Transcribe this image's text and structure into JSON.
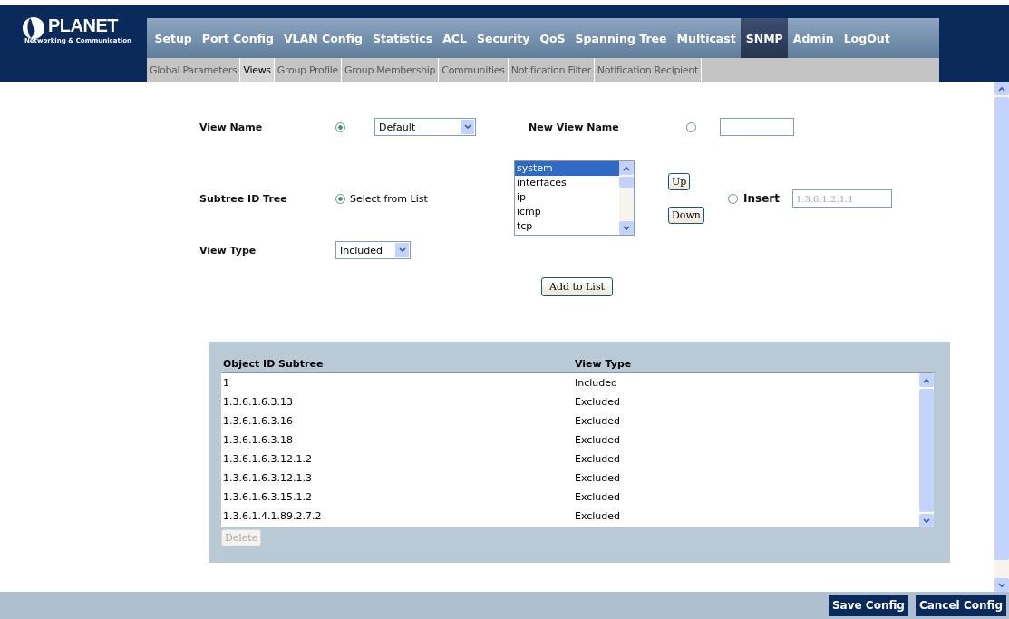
{
  "logo": {
    "name": "PLANET",
    "tagline": "Networking & Communication"
  },
  "menu": [
    {
      "label": "Setup",
      "selected": false
    },
    {
      "label": "Port Config",
      "selected": false
    },
    {
      "label": "VLAN Config",
      "selected": false
    },
    {
      "label": "Statistics",
      "selected": false
    },
    {
      "label": "ACL",
      "selected": false
    },
    {
      "label": "Security",
      "selected": false
    },
    {
      "label": "QoS",
      "selected": false
    },
    {
      "label": "Spanning Tree",
      "selected": false
    },
    {
      "label": "Multicast",
      "selected": false
    },
    {
      "label": "SNMP",
      "selected": true
    },
    {
      "label": "Admin",
      "selected": false
    },
    {
      "label": "LogOut",
      "selected": false
    }
  ],
  "subtabs": [
    {
      "label": "Global Parameters",
      "selected": false
    },
    {
      "label": "Views",
      "selected": true
    },
    {
      "label": "Group Profile",
      "selected": false
    },
    {
      "label": "Group Membership",
      "selected": false
    },
    {
      "label": "Communities",
      "selected": false
    },
    {
      "label": "Notification Filter",
      "selected": false
    },
    {
      "label": "Notification Recipient",
      "selected": false
    }
  ],
  "form": {
    "view_name": {
      "label": "View Name",
      "selected": true,
      "value": "Default"
    },
    "new_view_name": {
      "label": "New View Name",
      "selected": false
    },
    "subtree": {
      "label": "Subtree ID Tree",
      "select_option": {
        "label": "Select from List",
        "selected": true
      },
      "list": [
        {
          "label": "system",
          "selected": true
        },
        {
          "label": "interfaces",
          "selected": false
        },
        {
          "label": "ip",
          "selected": false
        },
        {
          "label": "icmp",
          "selected": false
        },
        {
          "label": "tcp",
          "selected": false
        }
      ],
      "up_button": "Up",
      "down_button": "Down",
      "insert_option": {
        "label": "Insert",
        "selected": false
      },
      "insert_value": "1.3.6.1.2.1.1",
      "insert_disabled": true
    },
    "view_type": {
      "label": "View Type",
      "value": "Included"
    },
    "add_button": "Add to List"
  },
  "table": {
    "columns": [
      "Object ID Subtree",
      "View Type"
    ],
    "rows": [
      [
        "1",
        "Included"
      ],
      [
        "1.3.6.1.6.3.13",
        "Excluded"
      ],
      [
        "1.3.6.1.6.3.16",
        "Excluded"
      ],
      [
        "1.3.6.1.6.3.18",
        "Excluded"
      ],
      [
        "1.3.6.1.6.3.12.1.2",
        "Excluded"
      ],
      [
        "1.3.6.1.6.3.12.1.3",
        "Excluded"
      ],
      [
        "1.3.6.1.6.3.15.1.2",
        "Excluded"
      ],
      [
        "1.3.6.1.4.1.89.2.7.2",
        "Excluded"
      ]
    ],
    "delete_button": {
      "label": "Delete",
      "disabled": true
    }
  },
  "footer": {
    "buttons": [
      "Save Config",
      "Cancel Config"
    ]
  }
}
